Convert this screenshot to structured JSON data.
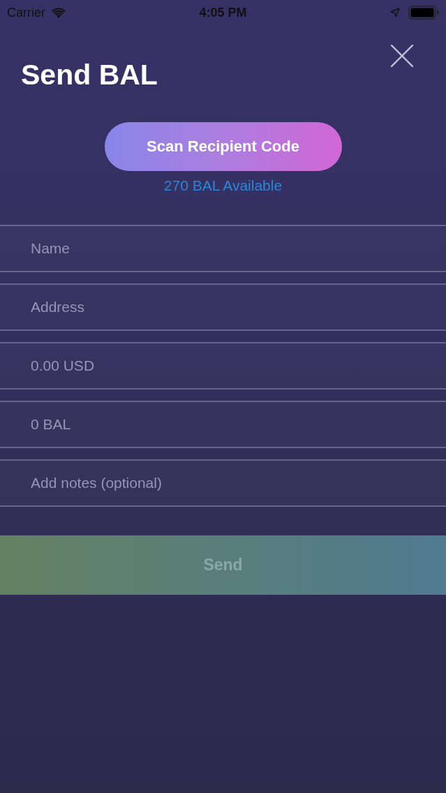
{
  "status_bar": {
    "carrier": "Carrier",
    "time": "4:05 PM"
  },
  "header": {
    "title": "Send BAL"
  },
  "scan_button": {
    "label": "Scan Recipient Code"
  },
  "balance": "270 BAL Available",
  "fields": [
    {
      "placeholder": "Name"
    },
    {
      "placeholder": "Address"
    },
    {
      "placeholder": "0.00 USD"
    },
    {
      "placeholder": "0 BAL"
    },
    {
      "placeholder": "Add notes (optional)"
    }
  ],
  "send_button": {
    "label": "Send",
    "disabled": true
  }
}
